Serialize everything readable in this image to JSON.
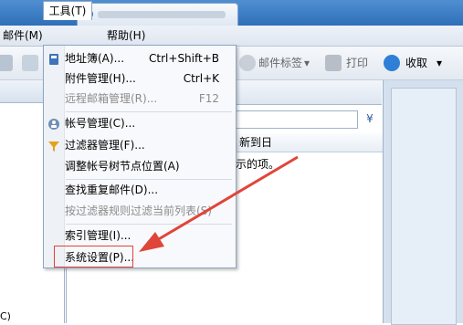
{
  "menubar": {
    "mail": "邮件(M)",
    "tools": "工具(T)",
    "help": "帮助(H)"
  },
  "toolbar": {
    "mail_tags": "邮件标签",
    "print": "打印",
    "receive": "收取"
  },
  "dropdown": {
    "items": [
      {
        "label": "地址簿(A)...",
        "shortcut": "Ctrl+Shift+B",
        "icon": "address-book-icon",
        "enabled": true
      },
      {
        "label": "附件管理(H)...",
        "shortcut": "Ctrl+K",
        "icon": "",
        "enabled": true
      },
      {
        "label": "远程邮箱管理(R)...",
        "shortcut": "F12",
        "icon": "",
        "enabled": false
      },
      {
        "label": "帐号管理(C)...",
        "shortcut": "",
        "icon": "accounts-icon",
        "enabled": true
      },
      {
        "label": "过滤器管理(F)...",
        "shortcut": "",
        "icon": "filter-icon",
        "enabled": true
      },
      {
        "label": "调整帐号树节点位置(A)",
        "shortcut": "",
        "icon": "",
        "enabled": true
      },
      {
        "label": "查找重复邮件(D)...",
        "shortcut": "",
        "icon": "",
        "enabled": true
      },
      {
        "label": "按过滤器规则过滤当前列表(S)",
        "shortcut": "",
        "icon": "",
        "enabled": false
      },
      {
        "label": "索引管理(I)...",
        "shortcut": "",
        "icon": "",
        "enabled": true
      },
      {
        "label": "系统设置(P)...",
        "shortcut": "",
        "icon": "",
        "enabled": true
      }
    ]
  },
  "list": {
    "column_header": "新到日",
    "empty_message": "示的项。"
  },
  "left_bottom": "C)",
  "colors": {
    "highlight": "#e0453a",
    "accent": "#2f6fb8"
  }
}
